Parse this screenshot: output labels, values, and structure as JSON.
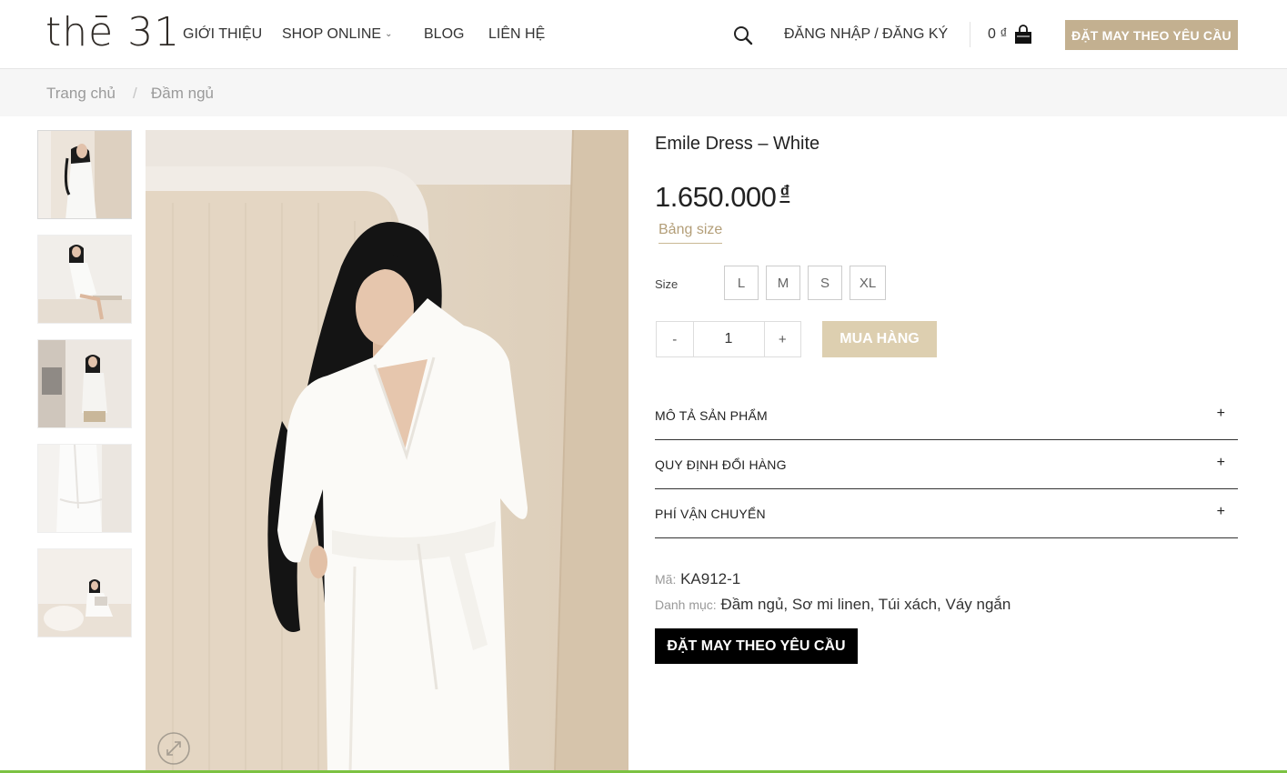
{
  "header": {
    "logo": "thē 31",
    "nav": [
      {
        "label": "GIỚI THIỆU"
      },
      {
        "label": "SHOP ONLINE"
      },
      {
        "label": "BLOG"
      },
      {
        "label": "LIÊN HỆ"
      }
    ],
    "login_label": "ĐĂNG NHẬP / ĐĂNG KÝ",
    "cart_total": "0 ₫",
    "cta_label": "ĐẶT MAY THEO YÊU CẦU"
  },
  "breadcrumb": {
    "home": "Trang chủ",
    "separator": "/",
    "current": "Đầm ngủ"
  },
  "product": {
    "title": "Emile Dress – White",
    "price": "1.650.000",
    "currency": "₫",
    "size_chart_link": "Bảng size",
    "size_label": "Size",
    "sizes": [
      "L",
      "M",
      "S",
      "XL"
    ],
    "qty_minus": "-",
    "qty_value": "1",
    "qty_plus": "+",
    "buy_label": "MUA HÀNG",
    "accordion": [
      {
        "label": "MÔ TẢ SẢN PHẨM",
        "icon": "+"
      },
      {
        "label": "QUY ĐỊNH ĐỔI HÀNG",
        "icon": "+"
      },
      {
        "label": "PHÍ VẬN CHUYỂN",
        "icon": "+"
      }
    ],
    "sku_label": "Mã:",
    "sku": "KA912-1",
    "category_label": "Danh mục:",
    "categories": "Đầm ngủ, Sơ mi linen, Túi xách, Váy ngắn",
    "custom_order_label": "ĐẶT MAY THEO YÊU CẦU"
  },
  "colors": {
    "accent": "#c3b090",
    "accent_light": "#ddcfb0",
    "link_gold": "#b39e78",
    "dark_button": "#000000"
  },
  "icons": [
    "search-icon",
    "shopping-bag-icon",
    "chevron-down-icon",
    "zoom-expand-icon"
  ]
}
